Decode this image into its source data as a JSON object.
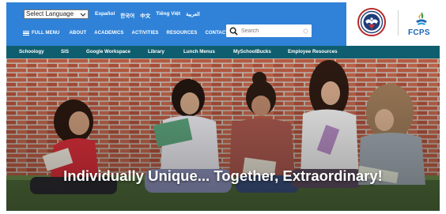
{
  "header": {
    "language_select": {
      "value": "Select Language",
      "icon": "chevron-down-icon"
    },
    "languages": [
      "Español",
      "한국어",
      "中文",
      "Tiếng Việt",
      "العربية"
    ],
    "full_menu_label": "FULL MENU",
    "nav": [
      "ABOUT",
      "ACADEMICS",
      "ACTIVITIES",
      "RESOURCES",
      "CONTACT"
    ],
    "search": {
      "placeholder": "Search",
      "icon": "search-icon"
    },
    "logo_text": "FCPS",
    "colors": {
      "header_blue": "#2f82d8",
      "nav_teal": "#0f5e70",
      "fcps_blue": "#1b66b5"
    }
  },
  "secondary_nav": [
    "Schoology",
    "SIS",
    "Google Workspace",
    "Library",
    "Lunch Menus",
    "MySchoolBucks",
    "Employee Resources"
  ],
  "hero": {
    "caption": "Individually Unique... Together, Extraordinary!"
  }
}
